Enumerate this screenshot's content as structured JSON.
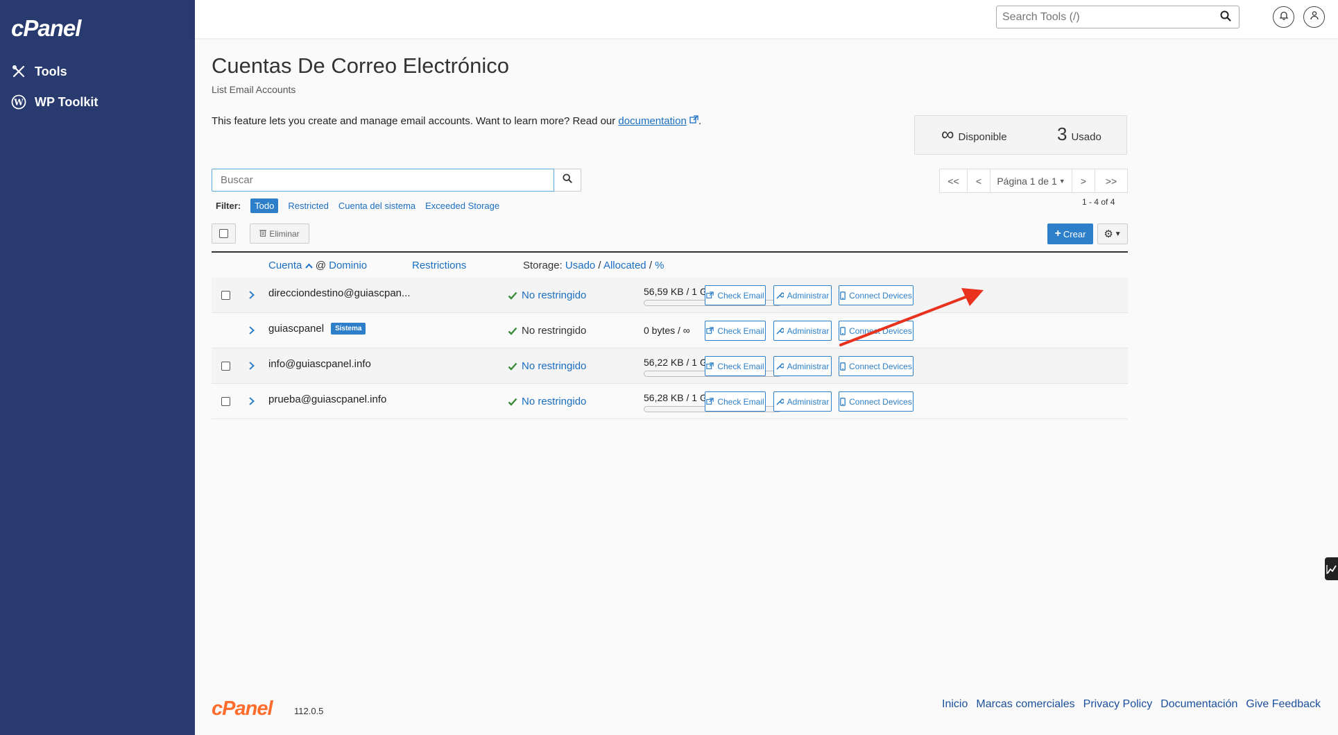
{
  "sidebar": {
    "brand": "cPanel",
    "items": [
      {
        "label": "Tools",
        "icon": "tools-icon"
      },
      {
        "label": "WP Toolkit",
        "icon": "wordpress-icon"
      }
    ]
  },
  "header": {
    "search_placeholder": "Search Tools (/)"
  },
  "page": {
    "title": "Cuentas De Correo Electrónico",
    "subtitle": "List Email Accounts",
    "intro_text": "This feature lets you create and manage email accounts. Want to learn more? Read our ",
    "intro_link": "documentation",
    "intro_end": "."
  },
  "stats": {
    "available_value": "∞",
    "available_label": "Disponible",
    "used_value": "3",
    "used_label": "Usado"
  },
  "search": {
    "placeholder": "Buscar"
  },
  "pagination": {
    "first": "<<",
    "prev": "<",
    "page_label": "Página 1 de 1",
    "next": ">",
    "last": ">>",
    "range": "1 - 4 of 4"
  },
  "filter": {
    "label": "Filter:",
    "options": [
      "Todo",
      "Restricted",
      "Cuenta del sistema",
      "Exceeded Storage"
    ],
    "active": "Todo"
  },
  "toolbar": {
    "delete_label": "Eliminar",
    "create_label": "Crear"
  },
  "table": {
    "col_account": "Cuenta",
    "col_at": "@",
    "col_domain": "Dominio",
    "col_restrictions": "Restrictions",
    "col_storage_prefix": "Storage:",
    "col_used": "Usado",
    "col_sep1": "/",
    "col_allocated": "Allocated",
    "col_sep2": "/",
    "col_percent": "%",
    "rows": [
      {
        "account": "direcciondestino@guiascpan...",
        "badge": "",
        "restriction": "No restringido",
        "storage": "56,59 KB / 1 GB / 0,01%",
        "usage_fraction": 0.0001,
        "has_checkbox": true
      },
      {
        "account": "guiascpanel",
        "badge": "Sistema",
        "restriction": "No restringido",
        "storage": "0 bytes / ∞",
        "usage_fraction": 0,
        "has_checkbox": false
      },
      {
        "account": "info@guiascpanel.info",
        "badge": "",
        "restriction": "No restringido",
        "storage": "56,22 KB / 1 GB / 0,01%",
        "usage_fraction": 0.0001,
        "has_checkbox": true
      },
      {
        "account": "prueba@guiascpanel.info",
        "badge": "",
        "restriction": "No restringido",
        "storage": "56,28 KB / 1 GB / 0,01%",
        "usage_fraction": 0.0001,
        "has_checkbox": true
      }
    ],
    "actions": {
      "check_email": "Check Email",
      "manage": "Administrar",
      "connect": "Connect Devices"
    }
  },
  "footer": {
    "logo": "cPanel",
    "version": "112.0.5",
    "links": [
      "Inicio",
      "Marcas comerciales",
      "Privacy Policy",
      "Documentación",
      "Give Feedback"
    ]
  },
  "colors": {
    "sidebar_bg": "#293a6e",
    "accent": "#2c7fc8",
    "footer_logo": "#ff6c2c",
    "annotation_arrow": "#e8321e",
    "check_green": "#3a8a3a"
  }
}
